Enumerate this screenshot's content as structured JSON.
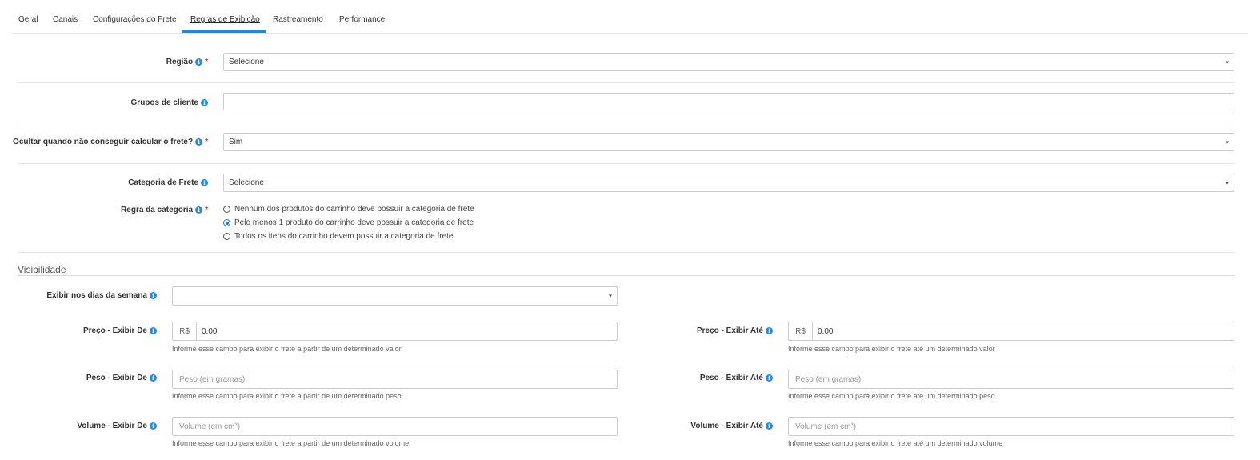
{
  "tabs": [
    {
      "label": "Geral"
    },
    {
      "label": "Canais"
    },
    {
      "label": "Configurações do Frete"
    },
    {
      "label": "Regras de Exibição",
      "active": true
    },
    {
      "label": "Rastreamento"
    },
    {
      "label": "Performance"
    }
  ],
  "fields": {
    "regiao": {
      "label": "Região",
      "value": "Selecione"
    },
    "grupos_cliente": {
      "label": "Grupos de cliente",
      "value": ""
    },
    "ocultar": {
      "label": "Ocultar quando não conseguir calcular o frete?",
      "value": "Sim"
    },
    "categoria_frete": {
      "label": "Categoria de Frete",
      "value": "Selecione"
    },
    "regra_categoria": {
      "label": "Regra da categoria",
      "options": [
        "Nenhum dos produtos do carrinho deve possuir a categoria de frete",
        "Pelo menos 1 produto do carrinho deve possuir a categoria de frete",
        "Todos os itens do carrinho devem possuir a categoria de frete"
      ],
      "selected_index": 1
    }
  },
  "visibilidade": {
    "title": "Visibilidade",
    "dias_semana": {
      "label": "Exibir nos dias da semana",
      "value": ""
    },
    "preco_de": {
      "label": "Preço - Exibir De",
      "prefix": "R$",
      "value": "0,00",
      "help": "Informe esse campo para exibir o frete a partir de um determinado valor"
    },
    "preco_ate": {
      "label": "Preço - Exibir Até",
      "prefix": "R$",
      "value": "0,00",
      "help": "Informe esse campo para exibir o frete até um determinado valor"
    },
    "peso_de": {
      "label": "Peso - Exibir De",
      "placeholder": "Peso (em gramas)",
      "help": "Informe esse campo para exibir o frete a partir de um determinado peso"
    },
    "peso_ate": {
      "label": "Peso - Exibir Até",
      "placeholder": "Peso (em gramas)",
      "help": "Informe esse campo para exibir o frete até um determinado peso"
    },
    "volume_de": {
      "label": "Volume - Exibir De",
      "placeholder": "Volume (em cm³)",
      "help": "Informe esse campo para exibir o frete a partir de um determinado volume"
    },
    "volume_ate": {
      "label": "Volume - Exibir Até",
      "placeholder": "Volume (em cm³)",
      "help": "Informe esse campo para exibir o frete até um determinado volume"
    }
  },
  "icons": {
    "info": "info-icon",
    "caret": "caret-down-icon",
    "required": "*"
  },
  "colors": {
    "accent": "#1e88e5",
    "required": "#d32f2f",
    "info": "#2a8ae2"
  }
}
